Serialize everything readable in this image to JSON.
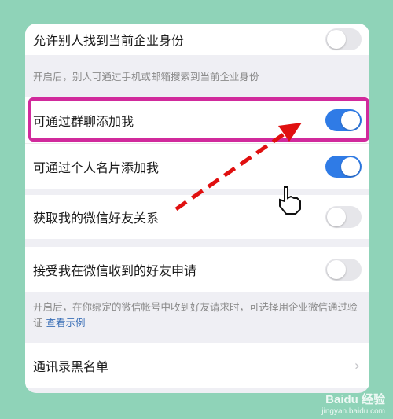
{
  "settings": {
    "allow_find": {
      "label": "允许别人找到当前企业身份",
      "toggle": "off",
      "description": "开启后，别人可通过手机或邮箱搜索到当前企业身份"
    },
    "add_via_group": {
      "label": "可通过群聊添加我",
      "toggle": "on"
    },
    "add_via_card": {
      "label": "可通过个人名片添加我",
      "toggle": "on"
    },
    "wechat_relation": {
      "label": "获取我的微信好友关系",
      "toggle": "off"
    },
    "accept_requests": {
      "label": "接受我在微信收到的好友申请",
      "toggle": "off",
      "description": "开启后，在你绑定的微信帐号中收到好友请求时，可选择用企业微信通过验证",
      "example_link": "查看示例"
    },
    "blacklist": {
      "label": "通讯录黑名单"
    }
  },
  "colors": {
    "background": "#8fd3b8",
    "toggle_on": "#2f7be6",
    "highlight": "#d12a9c",
    "arrow": "#e01010"
  },
  "watermark": {
    "brand": "Baidu 经验",
    "url": "jingyan.baidu.com"
  }
}
